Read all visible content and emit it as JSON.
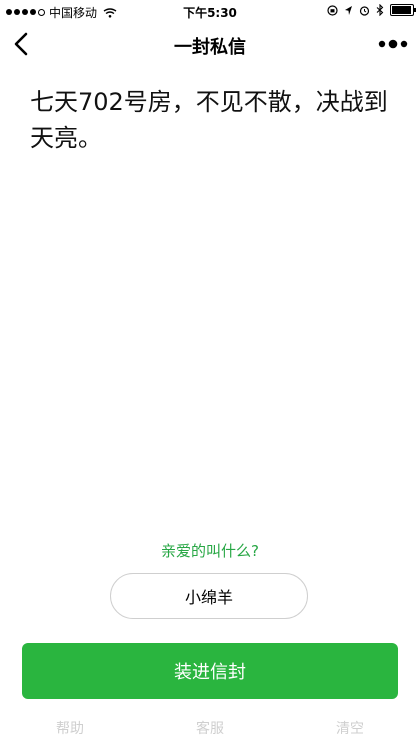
{
  "status_bar": {
    "carrier": "中国移动",
    "time": "下午5:30",
    "battery_level": 0.85
  },
  "nav": {
    "title": "一封私信",
    "back_icon": "chevron-left-icon",
    "more_icon": "more-dots-icon"
  },
  "letter": {
    "text": "七天702号房，不见不散，决战到天亮。"
  },
  "form": {
    "question": "亲爱的叫什么?",
    "name_value": "小绵羊",
    "submit_label": "装进信封"
  },
  "bottom_links": [
    {
      "label": "帮助"
    },
    {
      "label": "客服"
    },
    {
      "label": "清空"
    }
  ],
  "colors": {
    "accent_green": "#2ab53f",
    "question_green": "#28a745",
    "link_gray": "#cfcfcf"
  }
}
